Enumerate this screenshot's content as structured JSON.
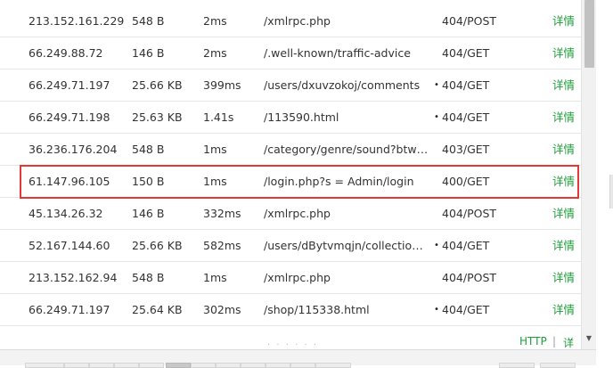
{
  "rows": [
    {
      "ip": "213.152.161.229",
      "size": "548 B",
      "time": "2ms",
      "path": "/xmlrpc.php",
      "dot": "",
      "status": "404/POST",
      "detail": "详情"
    },
    {
      "ip": "66.249.88.72",
      "size": "146 B",
      "time": "2ms",
      "path": "/.well-known/traffic-advice",
      "dot": "",
      "status": "404/GET",
      "detail": "详情"
    },
    {
      "ip": "66.249.71.197",
      "size": "25.66 KB",
      "time": "399ms",
      "path": "/users/dxuvzokoj/comments",
      "dot": "•",
      "status": "404/GET",
      "detail": "详情"
    },
    {
      "ip": "66.249.71.198",
      "size": "25.63 KB",
      "time": "1.41s",
      "path": "/113590.html",
      "dot": "•",
      "status": "404/GET",
      "detail": "详情"
    },
    {
      "ip": "36.236.176.204",
      "size": "548 B",
      "time": "1ms",
      "path": "/category/genre/sound?btwa...",
      "dot": "",
      "status": "403/GET",
      "detail": "详情"
    },
    {
      "ip": "61.147.96.105",
      "size": "150 B",
      "time": "1ms",
      "path": "/login.php?s = Admin/login",
      "dot": "",
      "status": "400/GET",
      "detail": "详情"
    },
    {
      "ip": "45.134.26.32",
      "size": "146 B",
      "time": "332ms",
      "path": "/xmlrpc.php",
      "dot": "",
      "status": "404/POST",
      "detail": "详情"
    },
    {
      "ip": "52.167.144.60",
      "size": "25.66 KB",
      "time": "582ms",
      "path": "/users/dBytvmqjn/collections...",
      "dot": "•",
      "status": "404/GET",
      "detail": "详情"
    },
    {
      "ip": "213.152.162.94",
      "size": "548 B",
      "time": "1ms",
      "path": "/xmlrpc.php",
      "dot": "",
      "status": "404/POST",
      "detail": "详情"
    },
    {
      "ip": "66.249.71.197",
      "size": "25.64 KB",
      "time": "302ms",
      "path": "/shop/115338.html",
      "dot": "•",
      "status": "404/GET",
      "detail": "详情"
    }
  ],
  "highlighted_row": 5,
  "footer": {
    "http_label": "HTTP",
    "separator": "|",
    "more_label": "详"
  },
  "colors": {
    "link": "#1e9e3a",
    "highlight": "#e53935"
  }
}
